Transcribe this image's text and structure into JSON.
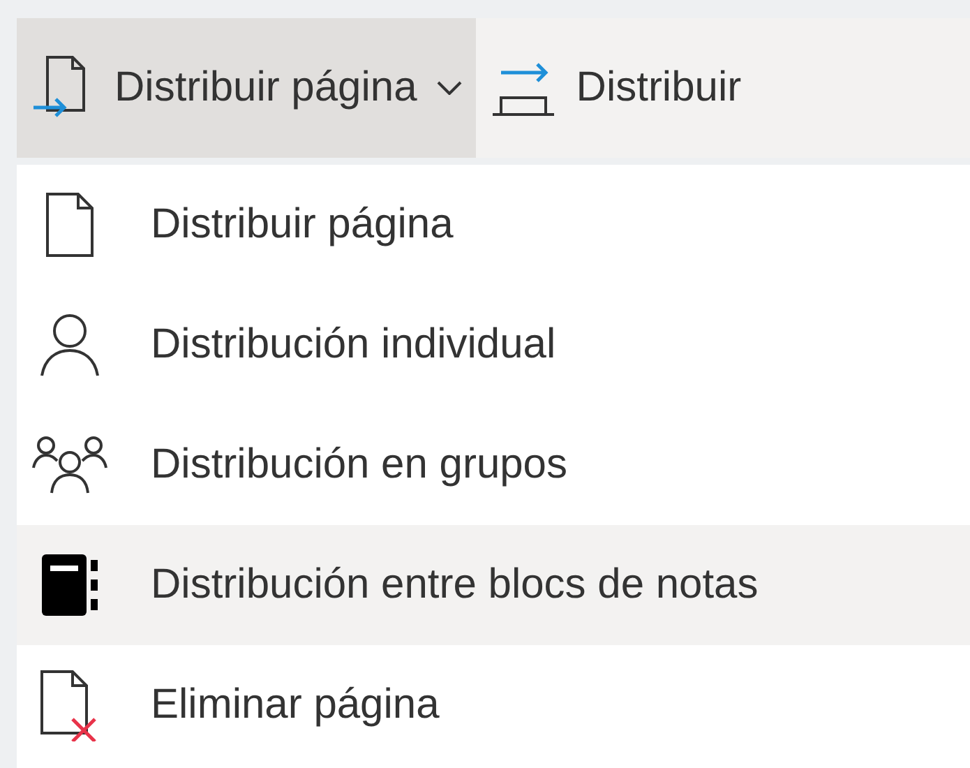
{
  "ribbon": [
    {
      "label": "Distribuir página",
      "kind": "dropdown",
      "expanded": true
    },
    {
      "label": "Distribuir",
      "kind": "plain",
      "expanded": false
    }
  ],
  "menu": [
    {
      "label": "Distribuir página",
      "kind": "page",
      "selected": false
    },
    {
      "label": "Distribución individual",
      "kind": "person",
      "selected": false
    },
    {
      "label": "Distribución en grupos",
      "kind": "people",
      "selected": false
    },
    {
      "label": "Distribución entre blocs de notas",
      "kind": "notebook",
      "selected": true
    },
    {
      "label": "Eliminar página",
      "kind": "delete",
      "selected": false
    }
  ]
}
